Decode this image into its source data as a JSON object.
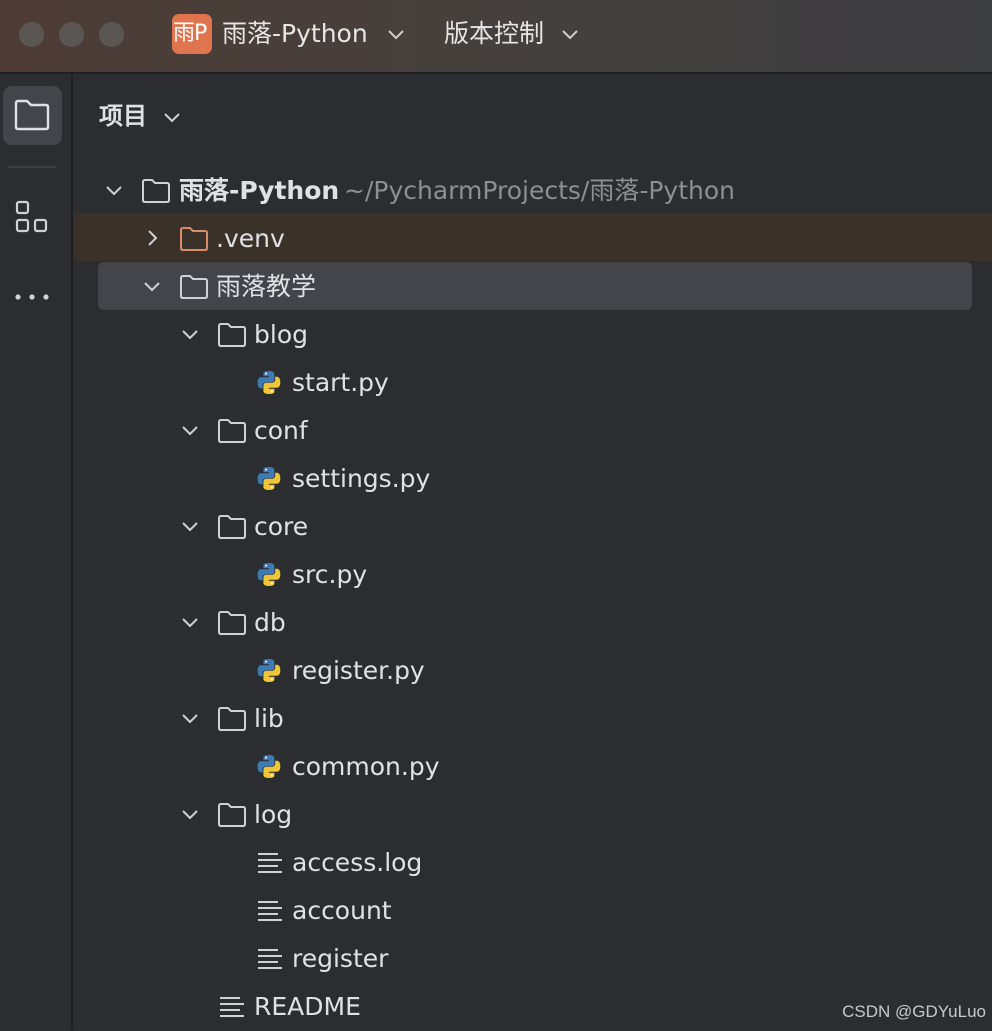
{
  "titlebar": {
    "badge_text": "雨P",
    "project_name": "雨落-Python",
    "vcs_label": "版本控制"
  },
  "toolstrip": {
    "icons": [
      "folder-icon",
      "structure-icon",
      "more-icon"
    ]
  },
  "panel": {
    "title": "项目"
  },
  "tree": {
    "root": {
      "name": "雨落-Python",
      "path": "~/PycharmProjects/雨落-Python"
    },
    "venv": ".venv",
    "main_folder": "雨落教学",
    "folders": [
      {
        "name": "blog",
        "file": "start.py"
      },
      {
        "name": "conf",
        "file": "settings.py"
      },
      {
        "name": "core",
        "file": "src.py"
      },
      {
        "name": "db",
        "file": "register.py"
      },
      {
        "name": "lib",
        "file": "common.py"
      }
    ],
    "log_folder": {
      "name": "log",
      "files": [
        "access.log",
        "account",
        "register"
      ]
    },
    "readme": "README"
  },
  "watermark": "CSDN @GDYuLuo",
  "colors": {
    "background": "#2b2d30",
    "selection": "#43454a",
    "excluded_highlight": "#3a3129",
    "excluded_folder": "#d98b6a",
    "badge": "#e0744f"
  }
}
